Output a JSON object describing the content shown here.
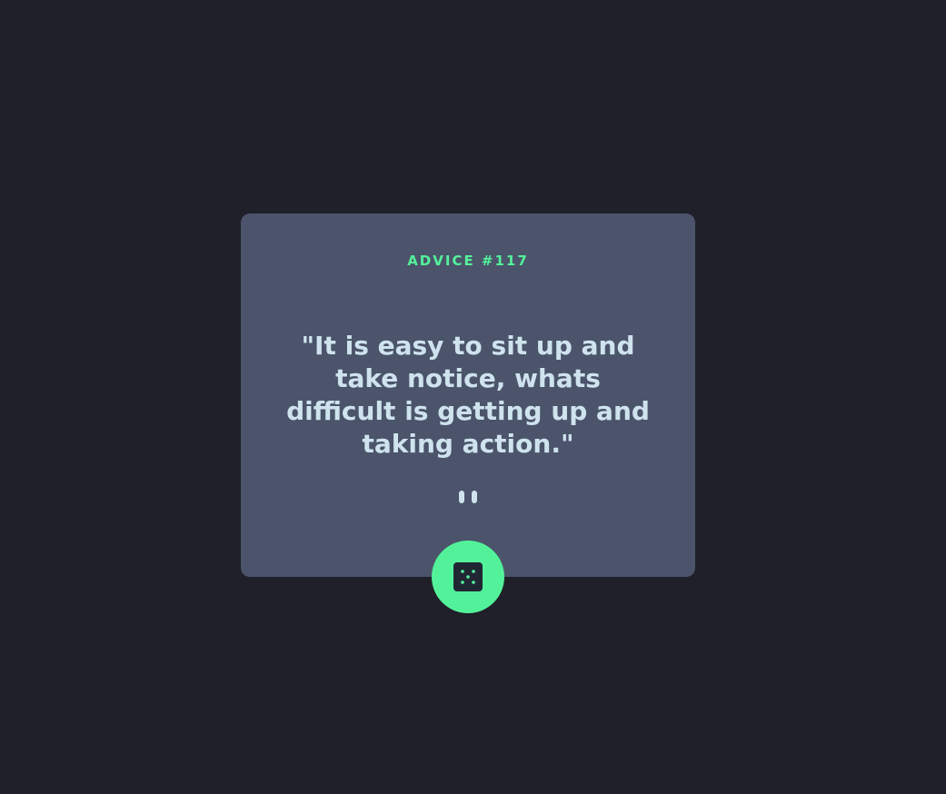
{
  "advice": {
    "label": "ADVICE #117",
    "text": "\"It is easy to sit up and take notice, whats difficult is getting up and taking action.\""
  },
  "divider": {
    "icon": "pause-icon"
  },
  "dice_button": {
    "icon": "dice-icon"
  },
  "colors": {
    "background": "#1f2029",
    "card": "#4b546a",
    "accent": "#53f29a",
    "text": "#cfe3ef"
  }
}
